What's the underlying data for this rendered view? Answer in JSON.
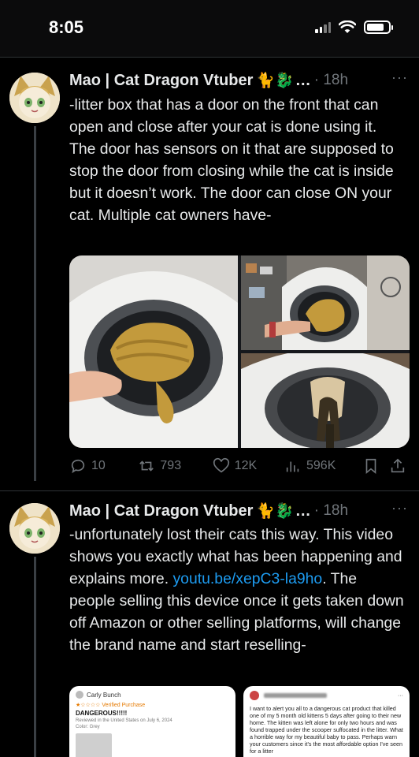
{
  "status_bar": {
    "time": "8:05"
  },
  "tweets": [
    {
      "author": "Mao | Cat Dragon Vtuber",
      "emojis": "🐈🐉",
      "ellipsis": "…",
      "time": "· 18h",
      "more": "···",
      "text": "-litter box that has a door on the front that can open and close after your cat is done using it. The door has sensors on it that are supposed to stop the door from closing while the cat is inside but it doesn’t work. The door can close ON your cat. Multiple cat owners have-",
      "media": [
        "litter-box-photo-1",
        "litter-box-photo-2",
        "litter-box-photo-3"
      ],
      "stats": {
        "replies": "10",
        "retweets": "793",
        "likes": "12K",
        "views": "596K"
      }
    },
    {
      "author": "Mao | Cat Dragon Vtuber",
      "emojis": "🐈🐉",
      "ellipsis": "…",
      "time": "· 18h",
      "more": "···",
      "text_before": "-unfortunately lost their cats this way. This video shows you exactly what has been happening and explains more. ",
      "link": "youtu.be/xepC3-la9ho",
      "text_after": ". The people selling this device once it gets taken down off Amazon or other selling platforms, will change the brand name and start reselling-",
      "review": {
        "name": "Carly Bunch",
        "stars": "★☆☆☆☆ Verified Purchase",
        "title": "DANGEROUS!!!!!",
        "meta": "Reviewed in the United States on July 6, 2024",
        "color": "Color: Grey"
      },
      "message": {
        "more": "···",
        "text": "I want to alert you all to a dangerous cat product that killed one of my 5 month old kittens 5 days after going to their new home. The kitten was left alone for only two hours and was found trapped under the scooper suffocated in the litter. What a horrible way for my beautiful baby to pass. Perhaps warn your customers since it's the most affordable option I've seen for a litter"
      }
    }
  ],
  "colors": {
    "background": "#000000",
    "text": "#e7e9ea",
    "muted": "#71767b",
    "link": "#1d9bf0",
    "divider": "#2f3336"
  }
}
